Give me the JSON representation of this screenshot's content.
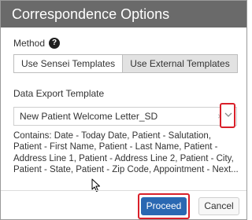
{
  "dialog": {
    "title": "Correspondence Options"
  },
  "method": {
    "label": "Method",
    "help_icon": "question-circle-icon",
    "options": [
      "Use Sensei Templates",
      "Use External Templates"
    ],
    "selected": "Use External Templates"
  },
  "data_export": {
    "label": "Data Export Template",
    "selected_value": "New Patient Welcome Letter_SD",
    "clear_icon": "×",
    "dropdown_icon": "chevron-down-icon",
    "contains_text": "Contains: Date - Today Date, Patient - Salutation,\nPatient - First Name, Patient - Last Name, Patient -\nAddress Line 1, Patient - Address Line 2, Patient - City,\nPatient - State, Patient - Zip Code, Appointment - Next..."
  },
  "footer": {
    "proceed_label": "Proceed",
    "cancel_label": "Cancel"
  },
  "colors": {
    "title_bar": "#6a6a6a",
    "primary_button": "#2a68b2",
    "highlight_outline": "#d9202a"
  }
}
